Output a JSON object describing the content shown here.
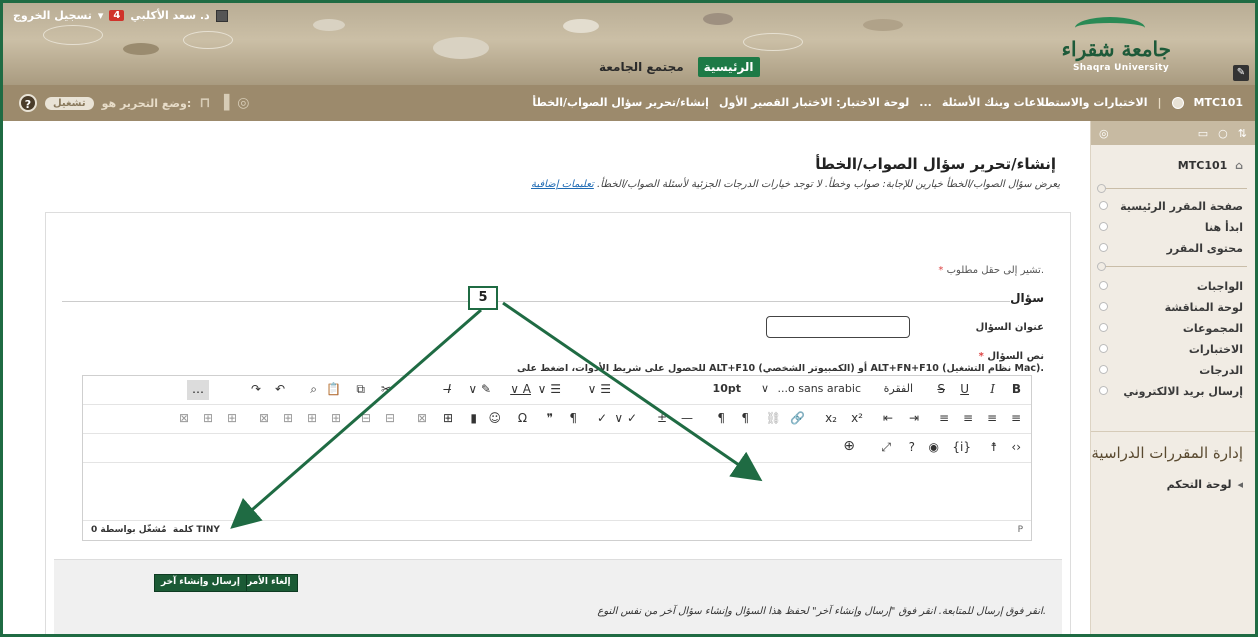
{
  "header": {
    "logout": "تسجيل الخروج",
    "notifications": "4",
    "user_name": "د. سعد الأكلبي",
    "tabs": [
      "الرئيسية",
      "مجتمع الجامعة"
    ],
    "logo_ar": "جامعة شقراء",
    "logo_en": "Shaqra University"
  },
  "breadcrumb": {
    "course": "MTC101",
    "items": [
      "الاختبارات والاستطلاعات وبنك الأسئلة",
      "...",
      "لوحة الاختبار: الاختبار القصير الأول",
      "إنشاء/تحرير سؤال الصواب/الخطأ"
    ],
    "edit_mode_label": "وضع التحرير هو:",
    "edit_mode_value": "تشغيل"
  },
  "sidebar": {
    "course": "MTC101",
    "items_a": [
      "صفحة المقرر الرئيسية",
      "ابدأ هنا",
      "محتوى المقرر"
    ],
    "items_b": [
      "الواجبات",
      "لوحة المناقشة",
      "المجموعات",
      "الاختبارات",
      "الدرجات",
      "إرسال بريد الالكتروني"
    ],
    "manage_heading": "إدارة المقررات الدراسية",
    "control_panel": "لوحة التحكم"
  },
  "main": {
    "title": "إنشاء/تحرير سؤال الصواب/الخطأ",
    "description": "يعرض سؤال الصواب/الخطأ خيارين للإجابة: صواب وخطأ. لا توجد خيارات الدرجات الجزئية لأسئلة الصواب/الخطأ.",
    "more_help": "تعليمات إضافية",
    "required_note": "تشير إلى حقل مطلوب.",
    "section_question": "سؤال",
    "question_title_label": "عنوان السؤال",
    "question_text_label": "نص السؤال",
    "toolbar_hint": "للحصول على شريط الأدوات، اضغط على ALT+F10 (الكمبيوتر الشخصي) أو ALT+FN+F10 (نظام التشغيل Mac).",
    "editor": {
      "paragraph": "الفقرة",
      "font": "...o sans arabic",
      "size": "10pt",
      "word_count": "0 كلمة",
      "powered": "مُشغّل بواسطة TINY",
      "path": "P"
    },
    "buttons": {
      "cancel": "إلغاء الأمر",
      "submit_another": "إرسال وإنشاء آخر"
    },
    "submit_note": "انقر فوق إرسال للمتابعة. انقر فوق \"إرسال وإنشاء آخر\" لحفظ هذا السؤال وإنشاء سؤال آخر من نفس النوع."
  },
  "callout": {
    "label": "5"
  }
}
